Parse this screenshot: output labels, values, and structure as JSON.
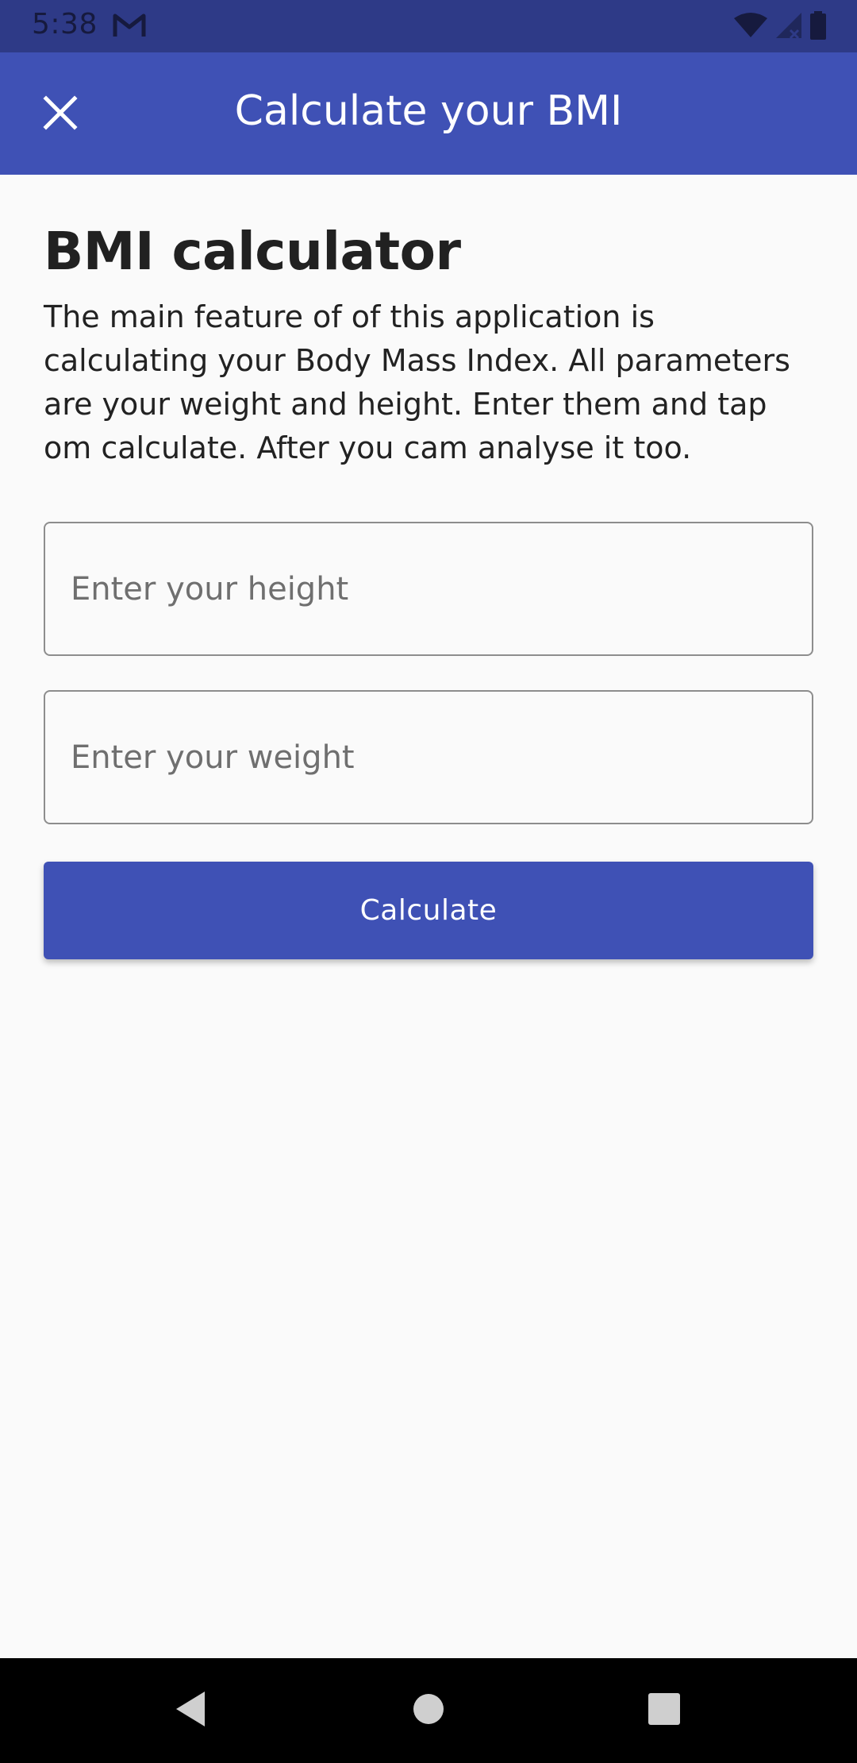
{
  "status_bar": {
    "time": "5:38",
    "notification_icon": "gmail-icon",
    "icons": [
      "wifi-icon",
      "signal-icon",
      "battery-icon"
    ],
    "background": "#2e3a87"
  },
  "app_bar": {
    "title": "Calculate your BMI",
    "close_icon": "close-icon",
    "background": "#3f51b5"
  },
  "main": {
    "heading": "BMI calculator",
    "description": "The main feature of of this application is calculating your Body Mass Index. All parameters are your weight and height. Enter them and tap om calculate. After you cam analyse it too.",
    "height_input": {
      "placeholder": "Enter your height",
      "value": ""
    },
    "weight_input": {
      "placeholder": "Enter your weight",
      "value": ""
    },
    "calculate_label": "Calculate",
    "accent": "#3f51b5"
  },
  "nav_bar": {
    "buttons": [
      "back-icon",
      "home-icon",
      "recents-icon"
    ]
  }
}
